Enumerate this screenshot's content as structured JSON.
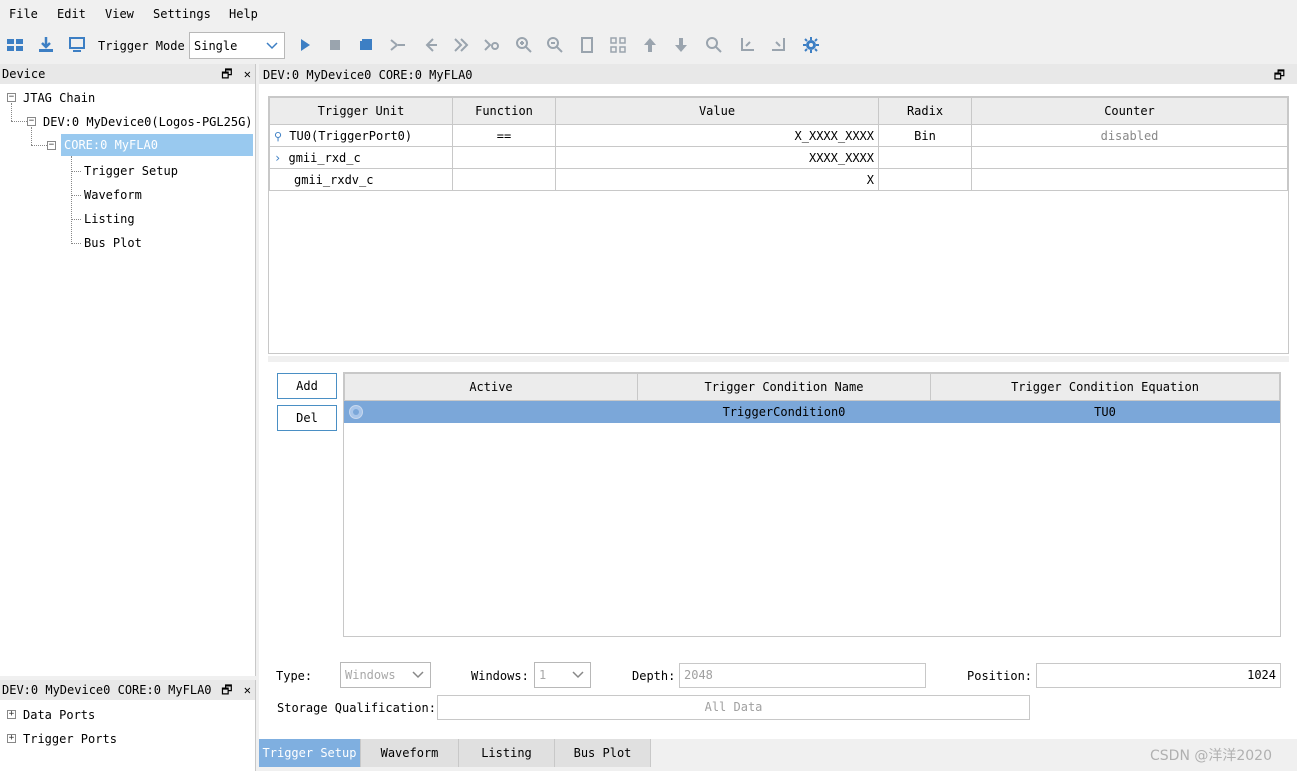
{
  "menu": {
    "file": "File",
    "edit": "Edit",
    "view": "View",
    "settings": "Settings",
    "help": "Help"
  },
  "toolbar": {
    "trigger_mode_label": "Trigger Mode",
    "trigger_mode_value": "Single"
  },
  "device_panel": {
    "title": "Device",
    "tree": {
      "jtag": "JTAG Chain",
      "dev": "DEV:0 MyDevice0(Logos-PGL25G)",
      "core": "CORE:0 MyFLA0",
      "children": [
        "Trigger Setup",
        "Waveform",
        "Listing",
        "Bus Plot"
      ]
    }
  },
  "ports_panel": {
    "title": "DEV:0 MyDevice0 CORE:0 MyFLA0",
    "items": [
      "Data Ports",
      "Trigger Ports"
    ]
  },
  "main_panel": {
    "title": "DEV:0 MyDevice0 CORE:0 MyFLA0"
  },
  "trigger_table": {
    "headers": [
      "Trigger Unit",
      "Function",
      "Value",
      "Radix",
      "Counter"
    ],
    "rows": [
      {
        "unit": "TU0(TriggerPort0)",
        "function": "==",
        "value": "X_XXXX_XXXX",
        "radix": "Bin",
        "counter": "disabled"
      },
      {
        "unit": "gmii_rxd_c",
        "function": "",
        "value": "XXXX_XXXX",
        "radix": "",
        "counter": ""
      },
      {
        "unit": "gmii_rxdv_c",
        "function": "",
        "value": "X",
        "radix": "",
        "counter": ""
      }
    ]
  },
  "condition_buttons": {
    "add": "Add",
    "del": "Del"
  },
  "condition_table": {
    "headers": [
      "Active",
      "Trigger Condition Name",
      "Trigger Condition Equation"
    ],
    "rows": [
      {
        "name": "TriggerCondition0",
        "equation": "TU0"
      }
    ]
  },
  "storage": {
    "type_label": "Type:",
    "type_value": "Windows",
    "windows_label": "Windows:",
    "windows_value": "1",
    "depth_label": "Depth:",
    "depth_value": "2048",
    "position_label": "Position:",
    "position_value": "1024",
    "qual_label": "Storage Qualification:",
    "qual_value": "All Data"
  },
  "tabs": [
    "Trigger Setup",
    "Waveform",
    "Listing",
    "Bus Plot"
  ],
  "watermark": "CSDN @洋洋2020",
  "colors": {
    "accent": "#4a8fc4",
    "selection": "#7ba7d9",
    "active_tab": "#7fafe0",
    "tree_selected": "#99c9ef"
  }
}
